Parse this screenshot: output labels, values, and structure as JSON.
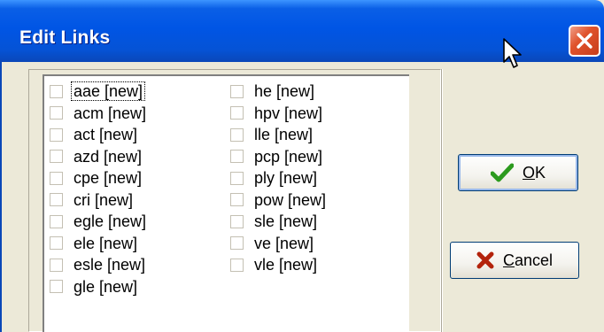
{
  "window": {
    "title": "Edit Links"
  },
  "links": {
    "column1": [
      {
        "label": "aae [new]",
        "checked": false,
        "focused": true
      },
      {
        "label": "acm [new]",
        "checked": false
      },
      {
        "label": "act [new]",
        "checked": false
      },
      {
        "label": "azd [new]",
        "checked": false
      },
      {
        "label": "cpe [new]",
        "checked": false
      },
      {
        "label": "cri [new]",
        "checked": false
      },
      {
        "label": "egle [new]",
        "checked": false
      },
      {
        "label": "ele [new]",
        "checked": false
      },
      {
        "label": "esle [new]",
        "checked": false
      },
      {
        "label": "gle [new]",
        "checked": false
      }
    ],
    "column2": [
      {
        "label": "he [new]",
        "checked": false
      },
      {
        "label": "hpv [new]",
        "checked": false
      },
      {
        "label": "lle [new]",
        "checked": false
      },
      {
        "label": "pcp [new]",
        "checked": false
      },
      {
        "label": "ply [new]",
        "checked": false
      },
      {
        "label": "pow [new]",
        "checked": false
      },
      {
        "label": "sle [new]",
        "checked": false
      },
      {
        "label": "ve [new]",
        "checked": false
      },
      {
        "label": "vle [new]",
        "checked": false
      }
    ]
  },
  "buttons": {
    "ok": {
      "prefix": "",
      "accel": "O",
      "rest": "K",
      "icon": "checkmark-icon",
      "color": "#2c9a1e"
    },
    "cancel": {
      "prefix": "",
      "accel": "C",
      "rest": "ancel",
      "icon": "x-icon",
      "color": "#b3230c"
    }
  },
  "colors": {
    "titlebar": "#0055e5",
    "dialog_bg": "#ece9d8",
    "close_button": "#e0532c"
  }
}
